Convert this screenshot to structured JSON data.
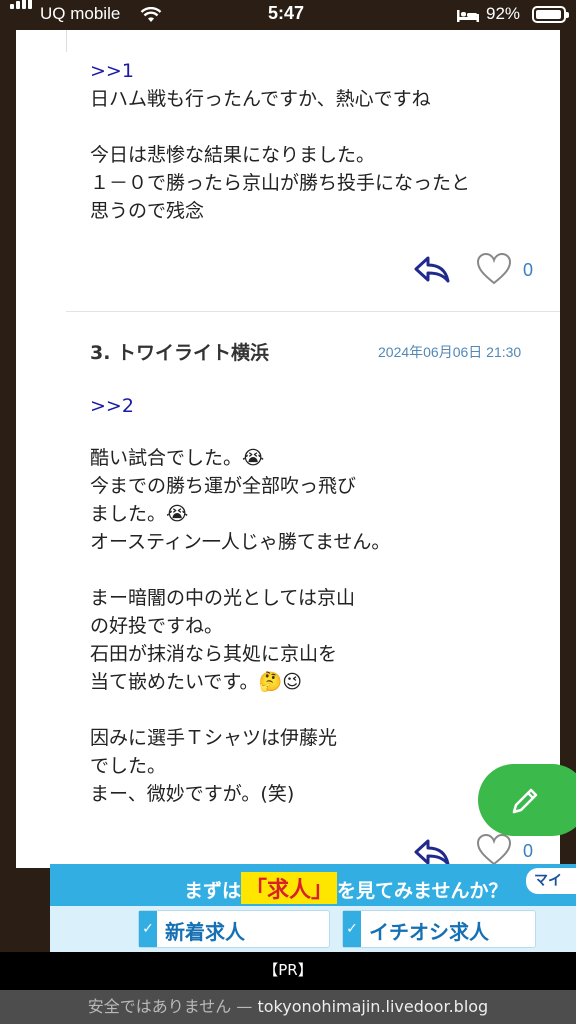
{
  "status_bar": {
    "carrier": "UQ mobile",
    "time": "5:47",
    "battery": "92%"
  },
  "comment_prev": {
    "anchor": ">>1",
    "body": "日ハム戦も行ったんですか、熱心ですね\n\n今日は悲惨な結果になりました。\n１－０で勝ったら京山が勝ち投手になったと\n思うので残念",
    "likes": "0"
  },
  "comment_3": {
    "title": "3.  トワイライト横浜",
    "date": "2024年06月06日 21:30",
    "anchor": ">>2",
    "body": "酷い試合でした。😭\n今までの勝ち運が全部吹っ飛び\nました。😭\nオースティン一人じゃ勝てません。\n\nまー暗闇の中の光としては京山\nの好投ですね。\n石田が抹消なら其処に京山を\n当て嵌めたいです。🤔😉\n\n因みに選手Ｔシャツは伊藤光\nでした。\nまー、微妙ですが。(笑)",
    "likes": "0"
  },
  "ad": {
    "headline_pre": "まずは",
    "headline_highlight": "「求人」",
    "headline_post": "を見てみませんか？",
    "logo": "マイ",
    "button1": "新着求人",
    "button2": "イチオシ求人"
  },
  "pr_label": "【PR】",
  "url_bar": {
    "warning": "安全ではありません",
    "separator": " — ",
    "domain": "tokyonohimajin.livedoor.blog"
  },
  "colors": {
    "accent_green": "#3bb94a",
    "link_blue": "#1a1aa6",
    "ad_blue": "#32aee2"
  },
  "icons": [
    "signal-icon",
    "wifi-icon",
    "bed-icon",
    "battery-icon",
    "reply-icon",
    "heart-icon",
    "pencil-icon",
    "check-icon"
  ]
}
